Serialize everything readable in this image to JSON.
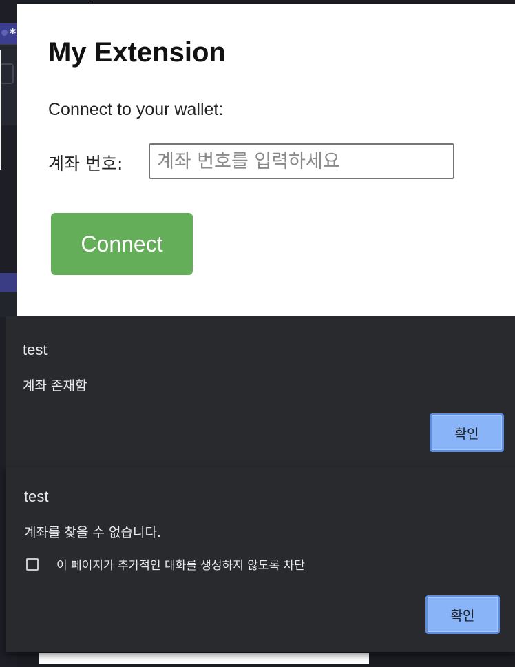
{
  "popup": {
    "title": "My Extension",
    "subtitle": "Connect to your wallet:",
    "account_label": "계좌 번호:",
    "account_placeholder": "계좌 번호를 입력하세요",
    "account_value": "",
    "connect_label": "Connect"
  },
  "dialog_1": {
    "title": "test",
    "message": "계좌 존재함",
    "ok_label": "확인"
  },
  "dialog_2": {
    "title": "test",
    "message": "계좌를 찾을 수 없습니다.",
    "block_label": "이 페이지가 추가적인 대화를 생성하지 않도록 차단",
    "block_checked": false,
    "ok_label": "확인"
  },
  "colors": {
    "connect_button": "#64ad59",
    "dialog_background": "#292a2d",
    "ok_button": "#8ab4f8"
  },
  "icons": {
    "tab": "star-icon"
  }
}
